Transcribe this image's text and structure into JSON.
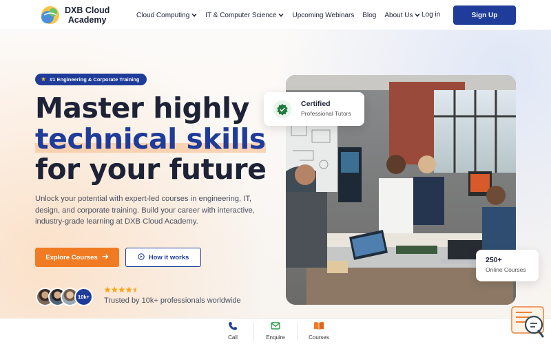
{
  "brand": {
    "name_line1": "DXB Cloud",
    "name_line2": "Academy"
  },
  "nav": {
    "items": [
      {
        "label": "Cloud Computing",
        "dropdown": true
      },
      {
        "label": "IT & Computer Science",
        "dropdown": true
      },
      {
        "label": "Upcoming Webinars",
        "dropdown": false
      },
      {
        "label": "Blog",
        "dropdown": false
      },
      {
        "label": "About Us",
        "dropdown": true
      }
    ],
    "login": "Log in",
    "signup": "Sign Up"
  },
  "hero": {
    "badge": "#1 Engineering & Corporate Training",
    "title_line1": "Master highly",
    "title_line2": "technical skills",
    "title_line3": "for your future",
    "description": "Unlock your potential with expert-led courses in engineering, IT, design, and corporate training. Build your career with interactive, industry-grade learning at DXB Cloud Academy.",
    "cta_primary": "Explore Courses",
    "cta_secondary": "How it works",
    "avatar_count": "10k+",
    "rating_stars": 4.5,
    "trusted_text": "Trusted by 10k+ professionals worldwide"
  },
  "cards": {
    "certified_title": "Certified",
    "certified_sub": "Professional Tutors",
    "online_num": "250+",
    "online_label": "Online Courses"
  },
  "bottom_bar": {
    "items": [
      {
        "label": "Call",
        "icon": "phone-icon"
      },
      {
        "label": "Enquire",
        "icon": "mail-icon"
      },
      {
        "label": "Courses",
        "icon": "book-icon"
      }
    ]
  },
  "colors": {
    "primary": "#1f3c9a",
    "accent": "#f07b22",
    "star": "#f6a81c"
  }
}
